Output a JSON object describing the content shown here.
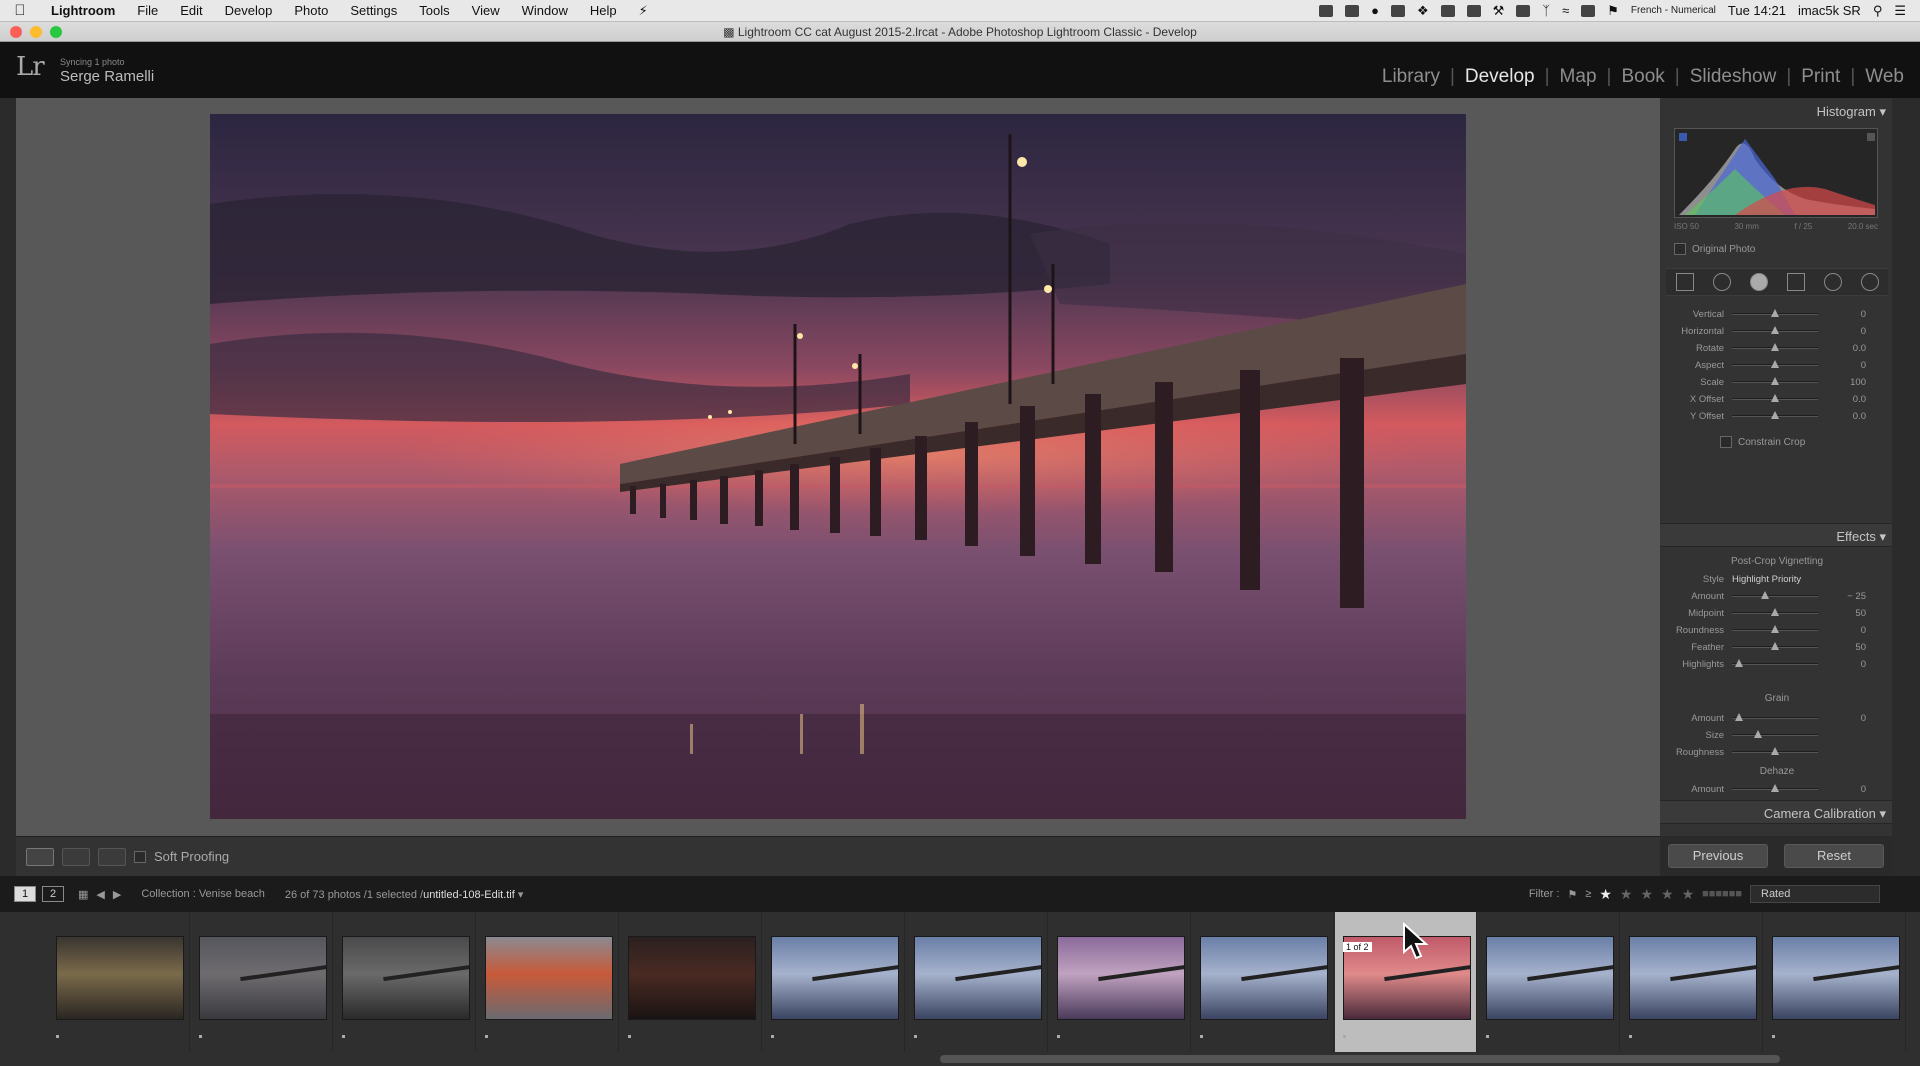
{
  "menubar": {
    "app": "Lightroom",
    "items": [
      "File",
      "Edit",
      "Develop",
      "Photo",
      "Settings",
      "Tools",
      "View",
      "Window",
      "Help"
    ],
    "input_source": "French - Numerical",
    "clock": "Tue 14:21",
    "computer": "imac5k SR"
  },
  "window": {
    "title": "Lightroom CC cat August 2015-2.lrcat - Adobe Photoshop Lightroom Classic - Develop"
  },
  "identity": {
    "logo": "Lr",
    "sync_status": "Syncing 1 photo",
    "user": "Serge Ramelli"
  },
  "modules": {
    "items": [
      "Library",
      "Develop",
      "Map",
      "Book",
      "Slideshow",
      "Print",
      "Web"
    ],
    "active": "Develop"
  },
  "toolbar": {
    "soft_proofing": "Soft Proofing"
  },
  "right_panel": {
    "histogram_title": "Histogram",
    "exif": {
      "iso": "ISO 50",
      "focal": "30 mm",
      "aperture": "f / 25",
      "shutter": "20.0 sec"
    },
    "original_photo": "Original Photo",
    "transform": [
      {
        "label": "Vertical",
        "value": "0",
        "pos": 0.5
      },
      {
        "label": "Horizontal",
        "value": "0",
        "pos": 0.5
      },
      {
        "label": "Rotate",
        "value": "0.0",
        "pos": 0.5
      },
      {
        "label": "Aspect",
        "value": "0",
        "pos": 0.5
      },
      {
        "label": "Scale",
        "value": "100",
        "pos": 0.5
      },
      {
        "label": "X Offset",
        "value": "0.0",
        "pos": 0.5
      },
      {
        "label": "Y Offset",
        "value": "0.0",
        "pos": 0.5
      }
    ],
    "constrain_crop": "Constrain Crop",
    "effects_title": "Effects",
    "vignette_title": "Post-Crop Vignetting",
    "style_label": "Style",
    "style_value": "Highlight Priority",
    "vignette": [
      {
        "label": "Amount",
        "value": "− 25",
        "pos": 0.38
      },
      {
        "label": "Midpoint",
        "value": "50",
        "pos": 0.5
      },
      {
        "label": "Roundness",
        "value": "0",
        "pos": 0.5
      },
      {
        "label": "Feather",
        "value": "50",
        "pos": 0.5
      },
      {
        "label": "Highlights",
        "value": "0",
        "pos": 0.08
      }
    ],
    "grain_title": "Grain",
    "grain": [
      {
        "label": "Amount",
        "value": "0",
        "pos": 0.08
      },
      {
        "label": "Size",
        "value": "",
        "pos": 0.3
      },
      {
        "label": "Roughness",
        "value": "",
        "pos": 0.5
      }
    ],
    "dehaze_title": "Dehaze",
    "dehaze": [
      {
        "label": "Amount",
        "value": "0",
        "pos": 0.5
      }
    ],
    "camera_calibration": "Camera Calibration",
    "previous": "Previous",
    "reset": "Reset"
  },
  "filmstrip_header": {
    "pages": [
      "1",
      "2"
    ],
    "collection": "Collection : Venise beach",
    "count": "26 of 73 photos /1 selected /",
    "filename": "untitled-108-Edit.tif",
    "filter_label": "Filter :",
    "rating_filter": "Rated"
  },
  "filmstrip": {
    "badge": "1 of 2",
    "selected_index": 9,
    "thumbs": [
      {
        "kind": "house"
      },
      {
        "kind": "pier_dark"
      },
      {
        "kind": "pier_silhouette"
      },
      {
        "kind": "sunset_sea"
      },
      {
        "kind": "dark_sunset"
      },
      {
        "kind": "pier_blue"
      },
      {
        "kind": "pier_blue"
      },
      {
        "kind": "pier_purple"
      },
      {
        "kind": "pier_blue"
      },
      {
        "kind": "pier_pink"
      },
      {
        "kind": "pier_blue"
      },
      {
        "kind": "pier_blue"
      },
      {
        "kind": "pier_blue"
      }
    ]
  },
  "colors": {
    "accent": "#e6e6e6",
    "panel_bg": "#333333",
    "canvas_bg": "#585858"
  }
}
